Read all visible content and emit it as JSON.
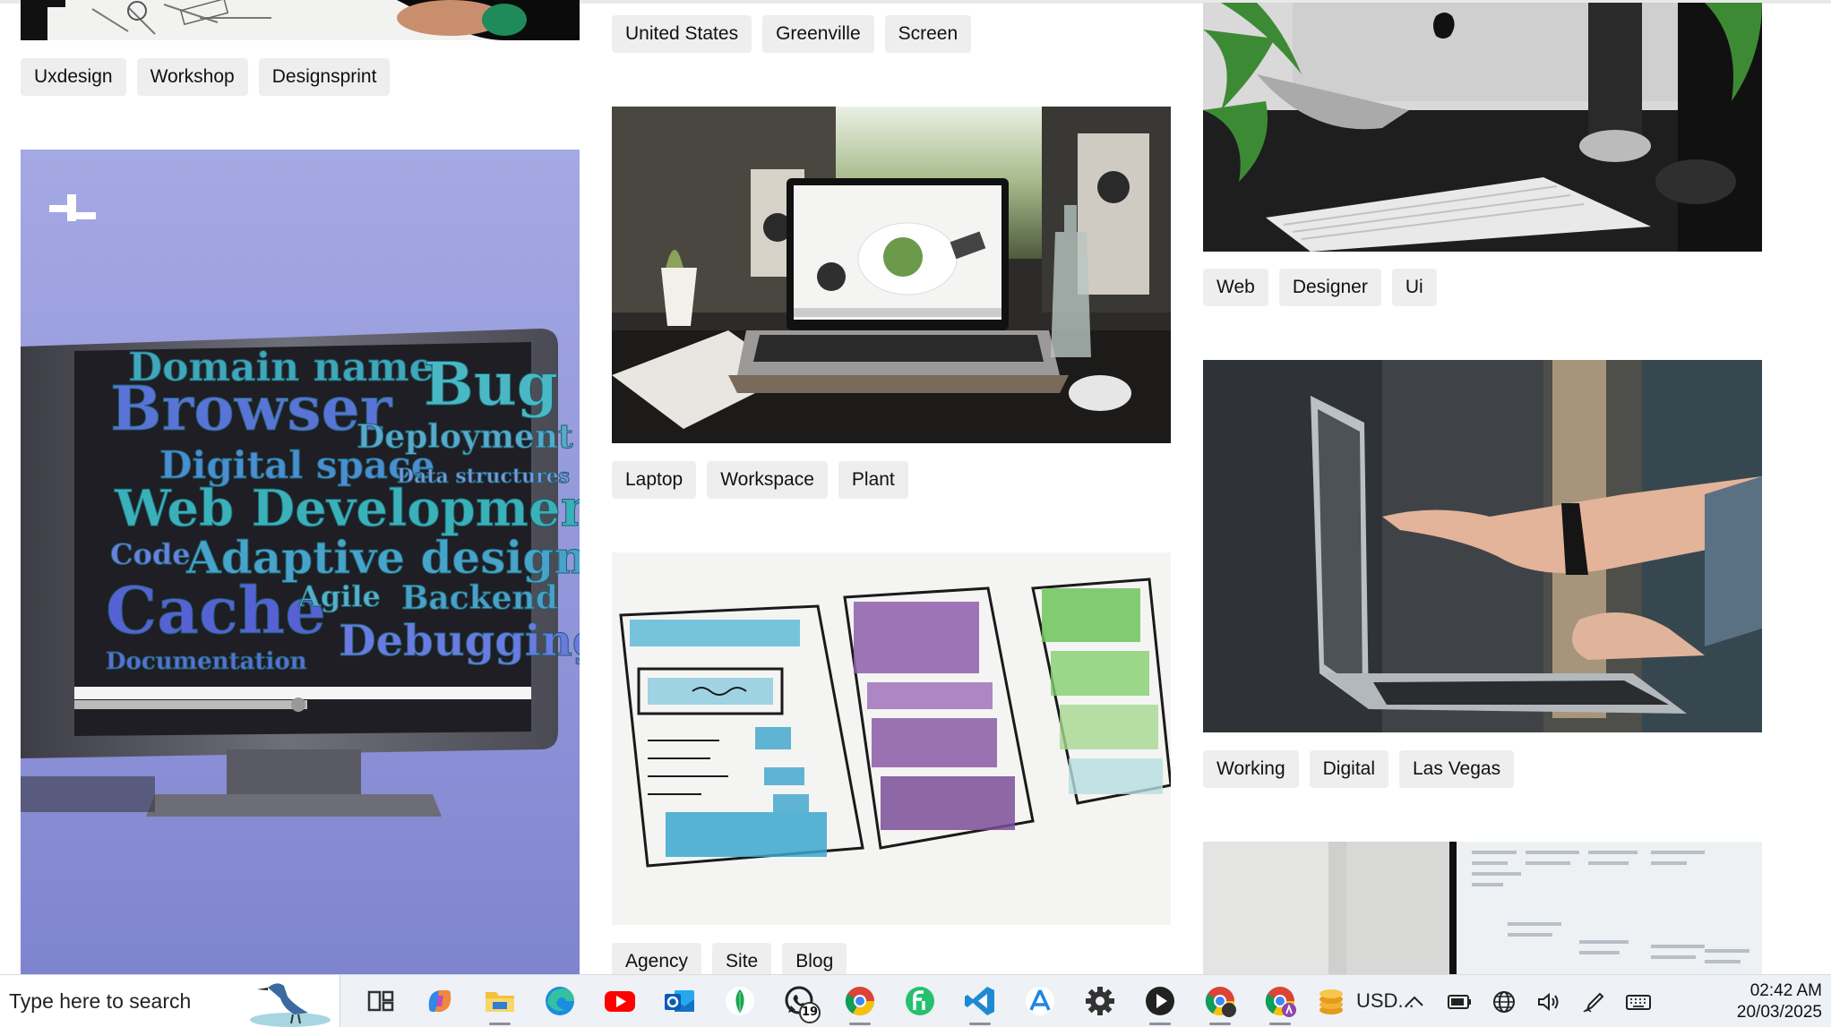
{
  "gallery": {
    "col1": {
      "tags_top": [
        "Uxdesign",
        "Workshop",
        "Designsprint"
      ],
      "poster_words": [
        "Domain name",
        "Bug",
        "Browser",
        "Deployment",
        "Digital space",
        "Data structures",
        "Web Development",
        "Code",
        "Adaptive design",
        "Cache",
        "Agile",
        "Backend",
        "Debugging",
        "Documentation"
      ]
    },
    "col2": {
      "tags_top": [
        "United States",
        "Greenville",
        "Screen"
      ],
      "tags_mid": [
        "Laptop",
        "Workspace",
        "Plant"
      ],
      "tags_bottom": [
        "Agency",
        "Site",
        "Blog"
      ]
    },
    "col3": {
      "tags_top": [
        "Web",
        "Designer",
        "Ui"
      ],
      "tags_mid": [
        "Working",
        "Digital",
        "Las Vegas"
      ]
    }
  },
  "taskbar": {
    "search_placeholder": "Type here to search",
    "apps": [
      "task-view-icon",
      "copilot-icon",
      "file-explorer-icon",
      "edge-icon",
      "youtube-icon",
      "outlook-icon",
      "mongodb-icon",
      "whatsapp-icon",
      "chrome-icon",
      "freshworks-icon",
      "vscode-icon",
      "app-store-icon",
      "settings-icon",
      "media-player-icon",
      "chrome-profile-icon",
      "chrome-profile-a-icon"
    ],
    "whatsapp_badge": "19",
    "ticker": "USD...",
    "time": "02:42 AM",
    "date": "20/03/2025"
  }
}
